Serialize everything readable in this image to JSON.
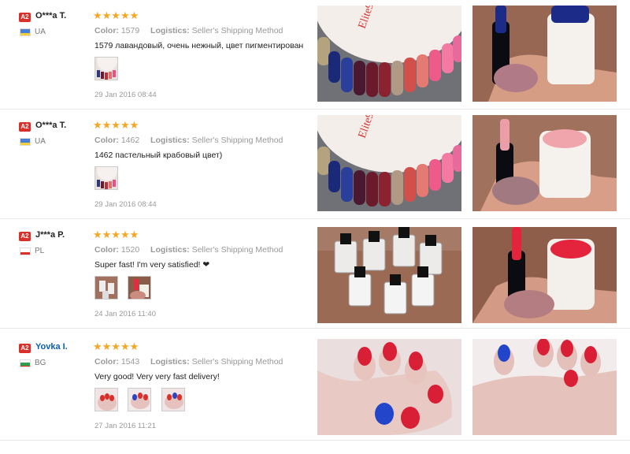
{
  "labels": {
    "color": "Color:",
    "logistics": "Logistics:",
    "badge": "A2",
    "stars": "★★★★★"
  },
  "reviews": [
    {
      "user": "O***a T.",
      "country": "UA",
      "flag_colors": [
        "#4a7fd6",
        "#f4d03f"
      ],
      "color_code": "1579",
      "shipping": "Seller's Shipping Method",
      "comment": "1579 лавандовый, очень нежный, цвет пигментирован",
      "date": "29 Jan 2016 08:44"
    },
    {
      "user": "O***a T.",
      "country": "UA",
      "flag_colors": [
        "#4a7fd6",
        "#f4d03f"
      ],
      "color_code": "1462",
      "shipping": "Seller's Shipping Method",
      "comment": "1462 пастельный крабовый цвет)",
      "date": "29 Jan 2016 08:44"
    },
    {
      "user": "J***a P.",
      "country": "PL",
      "flag_colors": [
        "#ffffff",
        "#d9302c"
      ],
      "color_code": "1520",
      "shipping": "Seller's Shipping Method",
      "comment": "Super fast! I'm very satisfied! ❤",
      "date": "24 Jan 2016 11:40"
    },
    {
      "user": "Yovka I.",
      "country": "BG",
      "flag_colors": [
        "#ffffff",
        "#2e9e4f",
        "#d9302c"
      ],
      "color_code": "1543",
      "shipping": "Seller's Shipping Method",
      "comment": "Very good! Very very fast delivery!",
      "date": "27 Jan 2016 11:21"
    }
  ],
  "colors": {
    "badge": "#d9302c",
    "star": "#f5a623",
    "link": "#0b5fb3",
    "muted": "#999999"
  }
}
